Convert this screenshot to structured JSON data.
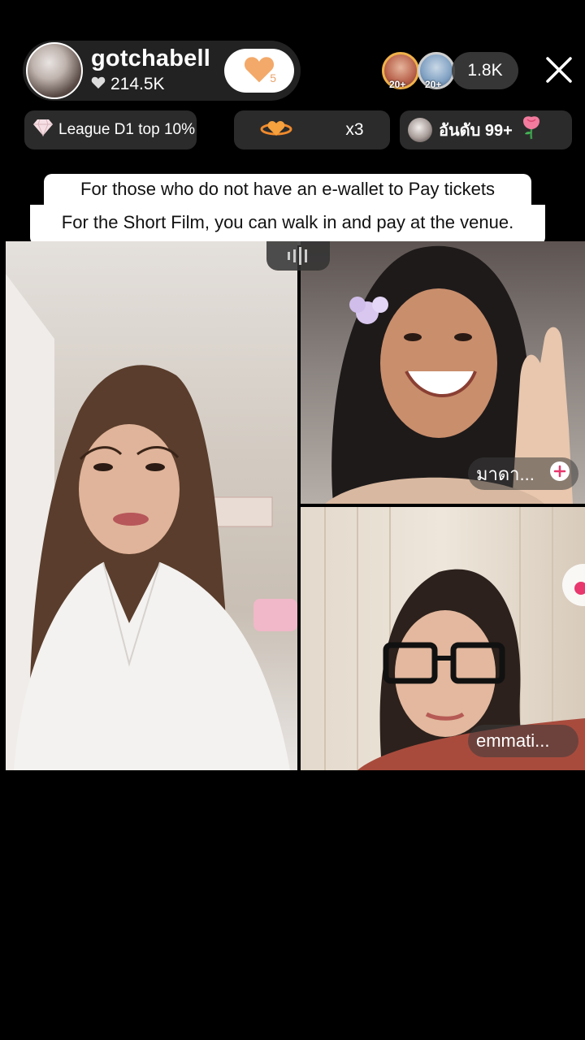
{
  "host": {
    "name": "gotchabell",
    "likes": "214.5K",
    "follow_count": "5"
  },
  "viewers": {
    "avatars": [
      {
        "badge": "20+",
        "ring": "#f0b24a"
      },
      {
        "badge": "20+",
        "ring": "#cfcfcf"
      }
    ],
    "count": "1.8K"
  },
  "chips": {
    "league": "League D1 top 10%",
    "streak": "x3",
    "rank": "อันดับ 99+"
  },
  "caption": {
    "line1": "For those who do not have an e-wallet to Pay tickets",
    "line2": "For the Short Film, you can walk in and pay at the venue."
  },
  "participants": [
    {
      "label": "มาดา..."
    },
    {
      "label": "emmati..."
    }
  ],
  "colors": {
    "follow_heart": "#f3a96a",
    "add_button": "#e8386d",
    "background": "#000000"
  }
}
